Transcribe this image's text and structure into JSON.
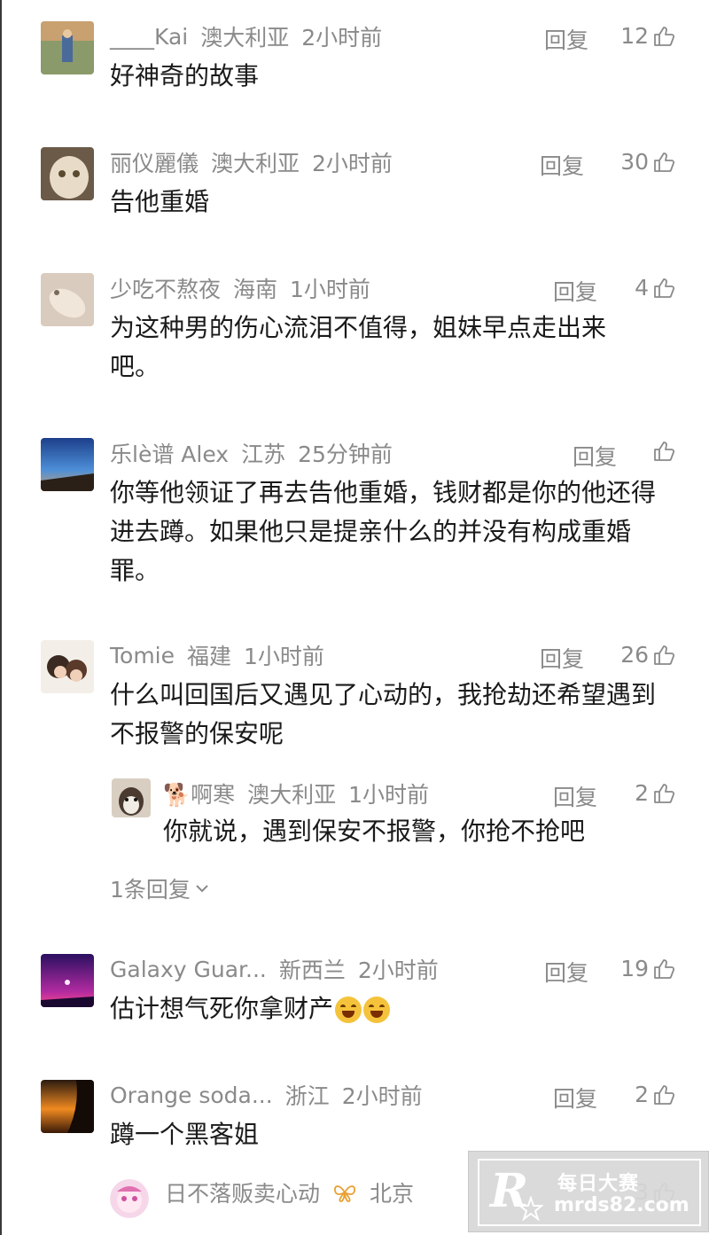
{
  "reply_label": "回复",
  "comments": [
    {
      "user": "____Kai",
      "location": "澳大利亚",
      "time": "2小时前",
      "likes": "12",
      "text": "好神奇的故事"
    },
    {
      "user": "丽仪麗儀",
      "location": "澳大利亚",
      "time": "2小时前",
      "likes": "30",
      "text": "告他重婚"
    },
    {
      "user": "少吃不熬夜",
      "location": "海南",
      "time": "1小时前",
      "likes": "4",
      "text": "为这种男的伤心流泪不值得，姐妹早点走出来吧。"
    },
    {
      "user": "乐lè谱 Alex",
      "location": "江苏",
      "time": "25分钟前",
      "likes": "",
      "text": "你等他领证了再去告他重婚，钱财都是你的他还得进去蹲。如果他只是提亲什么的并没有构成重婚罪。"
    },
    {
      "user": "Tomie",
      "location": "福建",
      "time": "1小时前",
      "likes": "26",
      "text": "什么叫回国后又遇见了心动的，我抢劫还希望遇到不报警的保安呢",
      "reply": {
        "user": "🐕啊寒",
        "location": "澳大利亚",
        "time": "1小时前",
        "likes": "2",
        "text": "你就说，遇到保安不报警，你抢不抢吧"
      },
      "more_replies": "1条回复"
    },
    {
      "user": "Galaxy Guar...",
      "location": "新西兰",
      "time": "2小时前",
      "likes": "19",
      "text": "估计想气死你拿财产"
    },
    {
      "user": "Orange soda...",
      "location": "浙江",
      "time": "2小时前",
      "likes": "2",
      "text": "蹲一个黑客姐"
    },
    {
      "user": "日不落贩卖心动",
      "location": "北京",
      "time": "",
      "likes": "3",
      "text": ""
    }
  ],
  "watermark": {
    "logo": "R",
    "name": "每日大赛",
    "url": "mrds82.com"
  }
}
